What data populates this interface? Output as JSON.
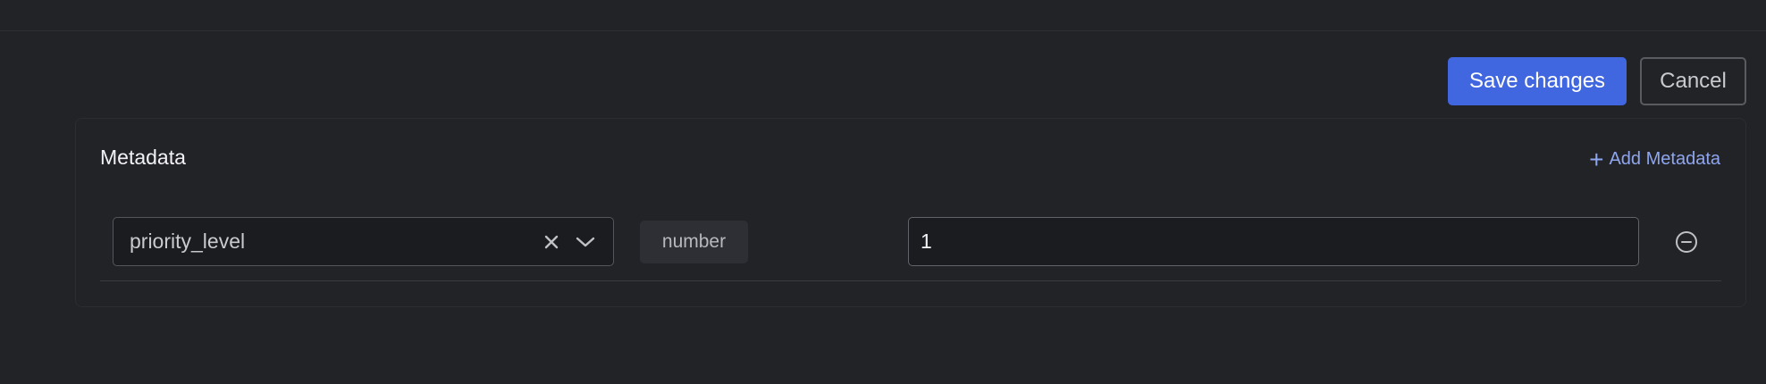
{
  "toolbar": {
    "save_label": "Save changes",
    "cancel_label": "Cancel"
  },
  "metadata": {
    "title": "Metadata",
    "add_label": "Add Metadata",
    "rows": [
      {
        "key": "priority_level",
        "type": "number",
        "value": "1"
      }
    ]
  },
  "icons": {
    "add": "plus-icon",
    "clear": "close-icon",
    "dropdown": "chevron-down-icon",
    "remove": "minus-circle-icon"
  },
  "colors": {
    "background": "#222327",
    "primary": "#4066e0",
    "link": "#8fa6ee",
    "input_bg": "#1b1c1f"
  }
}
